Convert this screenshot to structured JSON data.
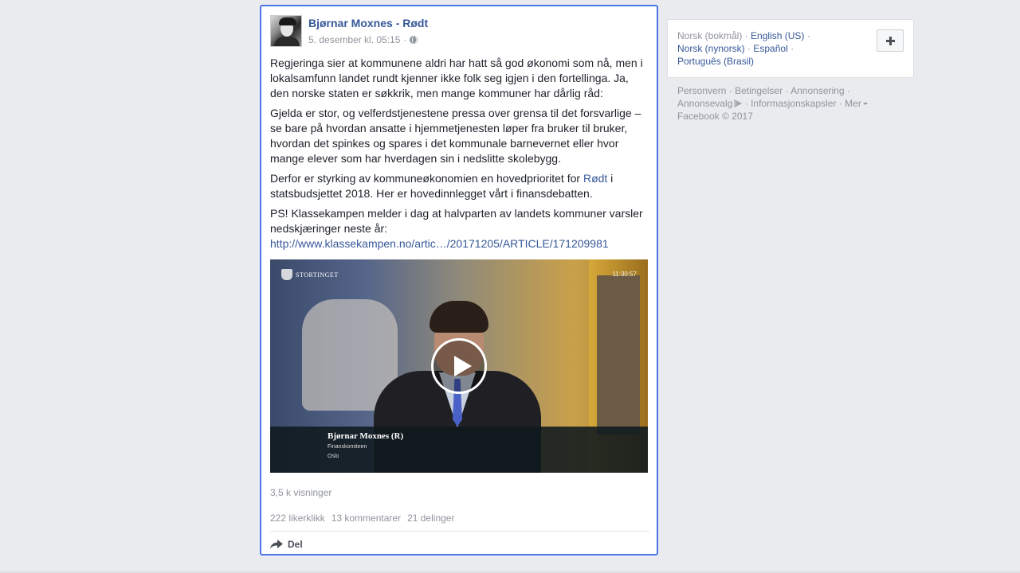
{
  "post": {
    "author": "Bjørnar Moxnes - Rødt",
    "timestamp": "5. desember kl. 05:15",
    "separator": "·",
    "paragraphs": {
      "p1": "Regjeringa sier at kommunene aldri har hatt så god økonomi som nå, men i lokalsamfunn landet rundt kjenner ikke folk seg igjen i den fortellinga. Ja, den norske staten er søkkrik, men mange kommuner har dårlig råd:",
      "p2": "Gjelda er stor, og velferdstjenestene pressa over grensa til det forsvarlige – se bare på hvordan ansatte i hjemmetjenesten løper fra bruker til bruker, hvordan det spinkes og spares i det kommunale barnevernet eller hvor mange elever som har hverdagen sin i nedslitte skolebygg.",
      "p3_before": "Derfor er styrking av kommuneøkonomien en hovedprioritet for ",
      "p3_link": "Rødt",
      "p3_after": " i statsbudsjettet 2018. Her er hovedinnlegget vårt i finansdebatten.",
      "p4": "PS! Klassekampen melder i dag at halvparten av landets kommuner varsler nedskjæringer neste år:",
      "p4_link": "http://www.klassekampen.no/artic…/20171205/ARTICLE/171209981"
    },
    "video": {
      "broadcaster": "STORTINGET",
      "timecode": "11:30:57",
      "lower_third_name": "Bjørnar Moxnes (R)",
      "lower_third_role": "Finanskomiteen",
      "lower_third_place": "Oslo"
    },
    "views": "3,5 k visninger",
    "likes": "222 likerklikk",
    "comments": "13 kommentarer",
    "shares": "21 delinger",
    "share_label": "Del"
  },
  "sidebar": {
    "languages": {
      "current": "Norsk (bokmål)",
      "english": "English (US)",
      "nynorsk": "Norsk (nynorsk)",
      "spanish": "Español",
      "portuguese": "Português (Brasil)",
      "sep": "·"
    },
    "footer": {
      "privacy": "Personvern",
      "terms": "Betingelser",
      "advertising": "Annonsering",
      "adchoices": "Annonsevalg",
      "cookies": "Informasjonskapsler",
      "more": "Mer",
      "copyright": "Facebook © 2017",
      "sep": "·"
    }
  },
  "colors": {
    "link": "#365899",
    "muted": "#90949c",
    "focus_border": "#4a76e8",
    "background": "#e9ebee"
  }
}
